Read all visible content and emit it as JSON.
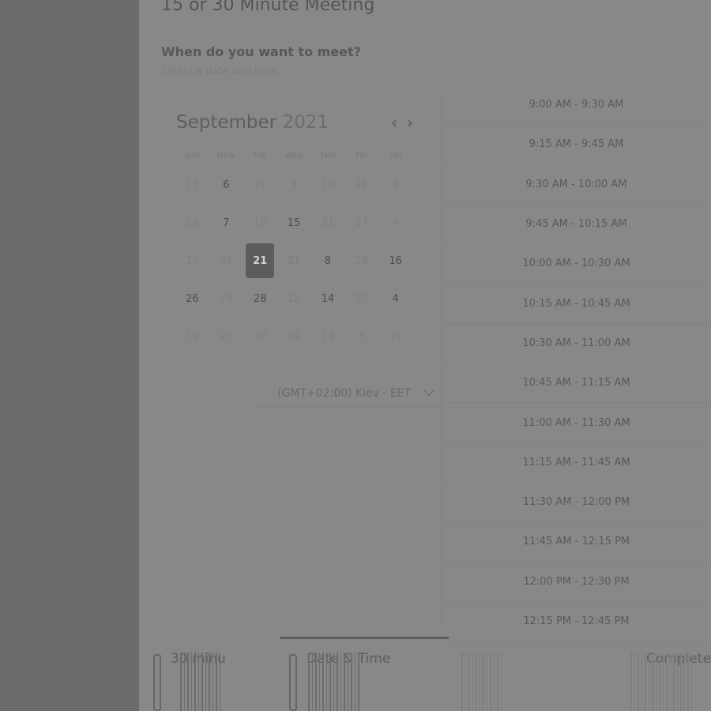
{
  "meeting": {
    "title": "15 or 30 Minute Meeting"
  },
  "picker": {
    "heading": "When do you want to meet?",
    "subheading": "Select a date and time"
  },
  "calendar": {
    "month": "September",
    "year": "2021",
    "weekdays": [
      "SUN",
      "MON",
      "TUE",
      "WED",
      "THU",
      "FRI",
      "SAT"
    ],
    "weeks": [
      [
        {
          "d": "15",
          "on": false
        },
        {
          "d": "6",
          "on": true
        },
        {
          "d": "22",
          "on": false
        },
        {
          "d": "3",
          "on": false
        },
        {
          "d": "10",
          "on": false
        },
        {
          "d": "21",
          "on": false
        },
        {
          "d": "4",
          "on": false
        }
      ],
      [
        {
          "d": "18",
          "on": false
        },
        {
          "d": "7",
          "on": true
        },
        {
          "d": "10",
          "on": false
        },
        {
          "d": "15",
          "on": true
        },
        {
          "d": "31",
          "on": false
        },
        {
          "d": "27",
          "on": false
        },
        {
          "d": "4",
          "on": false
        }
      ],
      [
        {
          "d": "14",
          "on": false
        },
        {
          "d": "31",
          "on": false
        },
        {
          "d": "21",
          "on": true,
          "selected": true
        },
        {
          "d": "31",
          "on": false
        },
        {
          "d": "8",
          "on": true
        },
        {
          "d": "29",
          "on": false
        },
        {
          "d": "16",
          "on": true
        }
      ],
      [
        {
          "d": "26",
          "on": true
        },
        {
          "d": "29",
          "on": false
        },
        {
          "d": "28",
          "on": true
        },
        {
          "d": "12",
          "on": false
        },
        {
          "d": "14",
          "on": true
        },
        {
          "d": "20",
          "on": false
        },
        {
          "d": "4",
          "on": true
        }
      ],
      [
        {
          "d": "19",
          "on": false
        },
        {
          "d": "27",
          "on": false
        },
        {
          "d": "20",
          "on": false
        },
        {
          "d": "24",
          "on": false
        },
        {
          "d": "14",
          "on": false
        },
        {
          "d": "3",
          "on": false
        },
        {
          "d": "19",
          "on": false
        }
      ]
    ],
    "icons": {
      "prev": "chevron-left-icon",
      "next": "chevron-right-icon"
    }
  },
  "timezone": {
    "value": "(GMT+02:00) Kiev - EET",
    "icon": "chevron-down-icon"
  },
  "slots": [
    "9:00 AM - 9:30 AM",
    "9:15 AM - 9:45 AM",
    "9:30 AM - 10:00 AM",
    "9:45 AM - 10:15 AM",
    "10:00 AM - 10:30 AM",
    "10:15 AM - 10:45 AM",
    "10:30 AM - 11:00 AM",
    "10:45 AM - 11:15 AM",
    "11:00 AM - 11:30 AM",
    "11:15 AM - 11:45 AM",
    "11:30 AM - 12:00 PM",
    "11:45 AM - 12:15 PM",
    "12:00 PM - 12:30 PM",
    "12:15 PM - 12:45 PM"
  ],
  "tabs": [
    {
      "label": "30 minu",
      "active": false
    },
    {
      "label": "Date & Time",
      "active": true
    },
    {
      "label": "",
      "active": false
    },
    {
      "label": "Complete",
      "active": false
    }
  ],
  "colors": {
    "page_bg": "#6b6b6b",
    "panel_bg": "#888888",
    "selected_day": "#5c5c5c"
  }
}
